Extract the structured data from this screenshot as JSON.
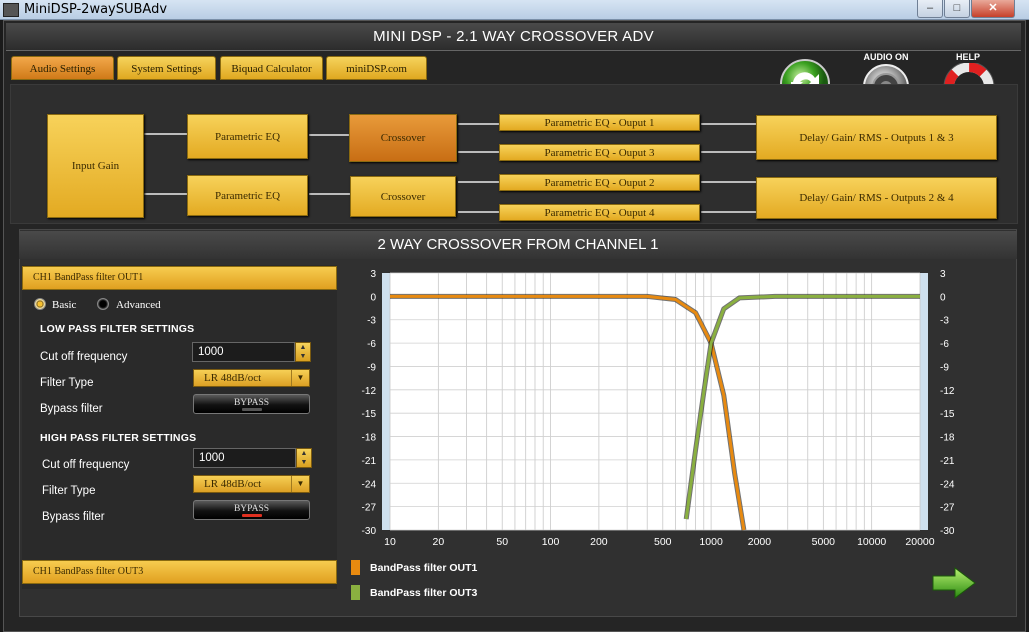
{
  "window": {
    "title": "MiniDSP-2waySUBAdv",
    "minimize": "–",
    "maximize": "□",
    "close": "✕"
  },
  "header": {
    "title": "MINI DSP - 2.1 WAY CROSSOVER ADV"
  },
  "tabs": [
    {
      "label": "Audio Settings",
      "active": true
    },
    {
      "label": "System Settings",
      "active": false
    },
    {
      "label": "Biquad Calculator",
      "active": false
    },
    {
      "label": "miniDSP.com",
      "active": false
    }
  ],
  "top_icons": {
    "sync_icon": "refresh-icon",
    "audio_on_label": "AUDIO ON",
    "help_label": "HELP"
  },
  "routing": {
    "input_gain": "Input Gain",
    "peq_top": "Parametric EQ",
    "peq_bottom": "Parametric EQ",
    "crossover_top": "Crossover",
    "crossover_bottom": "Crossover",
    "peq_out1": "Parametric EQ - Ouput 1",
    "peq_out3": "Parametric EQ - Ouput 3",
    "peq_out2": "Parametric EQ - Ouput 2",
    "peq_out4": "Parametric EQ - Ouput 4",
    "delay_13": "Delay/ Gain/ RMS - Outputs 1 & 3",
    "delay_24": "Delay/ Gain/ RMS - Outputs 2 & 4"
  },
  "panel": {
    "title": "2 WAY CROSSOVER FROM CHANNEL 1",
    "section_out1": "CH1 BandPass filter OUT1",
    "section_out3": "CH1 BandPass filter OUT3",
    "mode_basic": "Basic",
    "mode_advanced": "Advanced",
    "mode_selected": "Basic",
    "low_pass": {
      "heading": "LOW PASS FILTER SETTINGS",
      "cutoff_label": "Cut off frequency",
      "cutoff_value": "1000",
      "type_label": "Filter Type",
      "type_value": "LR 48dB/oct",
      "bypass_label": "Bypass filter",
      "bypass_button": "BYPASS",
      "bypass_led": "#555555"
    },
    "high_pass": {
      "heading": "HIGH PASS FILTER SETTINGS",
      "cutoff_label": "Cut off frequency",
      "cutoff_value": "1000",
      "type_label": "Filter Type",
      "type_value": "LR 48dB/oct",
      "bypass_label": "Bypass filter",
      "bypass_button": "BYPASS",
      "bypass_led": "#e03020"
    },
    "legend": [
      {
        "label": "BandPass filter OUT1",
        "color": "#e88a10"
      },
      {
        "label": "BandPass filter OUT3",
        "color": "#8ab040"
      }
    ],
    "next_icon": "right-arrow-icon"
  },
  "chart_data": {
    "type": "line",
    "x_scale": "log",
    "xlim": [
      10,
      20000
    ],
    "ylim": [
      -30,
      3
    ],
    "x_ticks": [
      "10",
      "20",
      "50",
      "100",
      "200",
      "500",
      "1000",
      "2000",
      "5000",
      "10000",
      "20000"
    ],
    "y_ticks": [
      "3",
      "0",
      "-3",
      "-6",
      "-9",
      "-12",
      "-15",
      "-18",
      "-21",
      "-24",
      "-27",
      "-30"
    ],
    "grid": true,
    "series": [
      {
        "name": "BandPass filter OUT1",
        "color": "#e88a10",
        "filter": "lowpass",
        "cutoff": 1000,
        "order": 8,
        "x": [
          10,
          100,
          400,
          600,
          800,
          1000,
          1200,
          1400,
          1600
        ],
        "y": [
          0,
          0,
          0,
          -0.4,
          -2.1,
          -6,
          -12.7,
          -22.7,
          -30
        ]
      },
      {
        "name": "BandPass filter OUT3",
        "color": "#8ab040",
        "filter": "highpass",
        "cutoff": 1000,
        "order": 8,
        "x": [
          700,
          800,
          900,
          1000,
          1200,
          1500,
          2500,
          5000,
          20000
        ],
        "y": [
          -28.6,
          -19.7,
          -12.3,
          -6,
          -1.6,
          -0.2,
          0,
          0,
          0
        ]
      }
    ]
  }
}
